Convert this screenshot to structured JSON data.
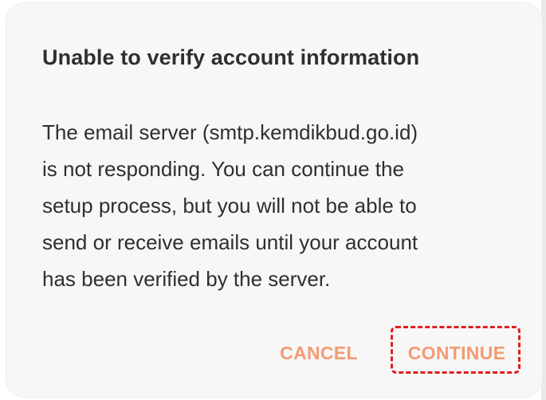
{
  "dialog": {
    "title": "Unable to verify account information",
    "message": "The email server (smtp.kemdikbud.go.id)\nis not responding. You can continue the\nsetup process, but you will not be able to\nsend or receive emails until your account\nhas been verified by the server.",
    "actions": {
      "cancel": "CANCEL",
      "continue": "CONTINUE"
    }
  },
  "colors": {
    "dialog_background": "#f7f7f7",
    "text": "#2f2f2f",
    "action_text": "#f39b73",
    "highlight": "#dd1f1f"
  }
}
